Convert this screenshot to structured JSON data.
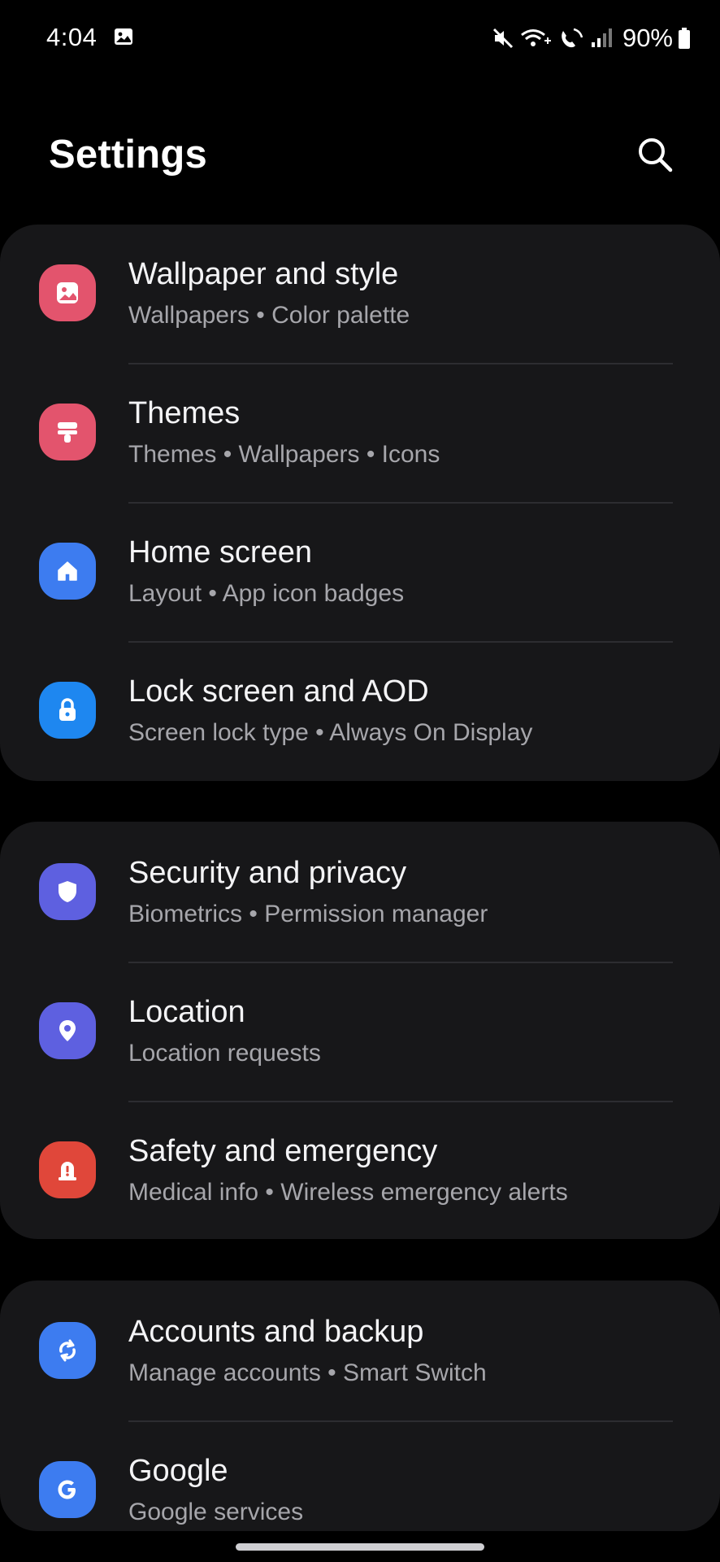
{
  "status_bar": {
    "time": "4:04",
    "battery": "90%",
    "icons": [
      "gallery-notification-icon",
      "mute-icon",
      "wifi-calling-icon",
      "volte-icon",
      "signal-icon",
      "battery-icon"
    ]
  },
  "header": {
    "title": "Settings",
    "search_icon": "search-icon"
  },
  "groups": [
    {
      "items": [
        {
          "title": "Wallpaper and style",
          "subtitle": "Wallpapers  •  Color palette",
          "icon": "wallpaper-icon",
          "color": "#e3546d"
        },
        {
          "title": "Themes",
          "subtitle": "Themes  •  Wallpapers  •  Icons",
          "icon": "themes-icon",
          "color": "#e3546d"
        },
        {
          "title": "Home screen",
          "subtitle": "Layout  •  App icon badges",
          "icon": "home-icon",
          "color": "#3d7cf0"
        },
        {
          "title": "Lock screen and AOD",
          "subtitle": "Screen lock type  •  Always On Display",
          "icon": "lock-icon",
          "color": "#1e87f0"
        }
      ]
    },
    {
      "items": [
        {
          "title": "Security and privacy",
          "subtitle": "Biometrics  •  Permission manager",
          "icon": "shield-icon",
          "color": "#5e60e0"
        },
        {
          "title": "Location",
          "subtitle": "Location requests",
          "icon": "location-pin-icon",
          "color": "#5e60e0"
        },
        {
          "title": "Safety and emergency",
          "subtitle": "Medical info  •  Wireless emergency alerts",
          "icon": "emergency-alert-icon",
          "color": "#e0473a"
        }
      ]
    },
    {
      "items": [
        {
          "title": "Accounts and backup",
          "subtitle": "Manage accounts  •  Smart Switch",
          "icon": "sync-icon",
          "color": "#3d7cf0"
        },
        {
          "title": "Google",
          "subtitle": "Google services",
          "icon": "google-icon",
          "color": "#3d7cf0"
        }
      ]
    }
  ],
  "colors": {
    "background": "#000000",
    "card": "#171719",
    "title_text": "#f4f4f6",
    "subtitle_text": "#a6a6ab",
    "divider": "#2d2d31"
  }
}
